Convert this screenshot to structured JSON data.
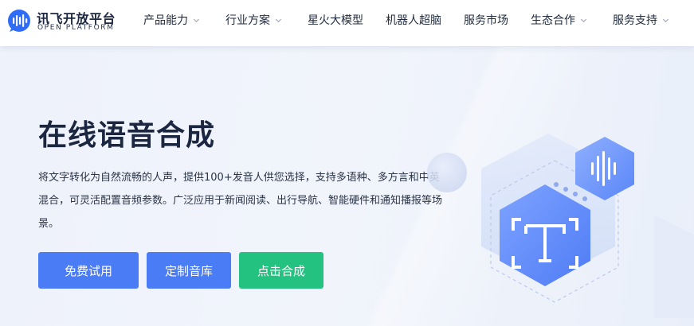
{
  "brand": {
    "name_cn": "讯飞开放平台",
    "name_en": "OPEN PLATFORM"
  },
  "nav": {
    "items": [
      {
        "label": "产品能力",
        "has_dropdown": true
      },
      {
        "label": "行业方案",
        "has_dropdown": true
      },
      {
        "label": "星火大模型",
        "has_dropdown": false
      },
      {
        "label": "机器人超脑",
        "has_dropdown": false
      },
      {
        "label": "服务市场",
        "has_dropdown": false
      },
      {
        "label": "生态合作",
        "has_dropdown": true
      },
      {
        "label": "服务支持",
        "has_dropdown": true
      }
    ]
  },
  "hero": {
    "title": "在线语音合成",
    "description": "将文字转化为自然流畅的人声，提供100+发音人供您选择，支持多语种、多方言和中英混合，可灵活配置音频参数。广泛应用于新闻阅读、出行导航、智能硬件和通知播报等场景。",
    "buttons": {
      "trial": "免费试用",
      "custom": "定制音库",
      "synthesize": "点击合成"
    }
  },
  "icons": {
    "logo": "audio-wave-cloud-icon",
    "dropdown": "chevron-down-icon",
    "text_recognition": "text-t-icon",
    "sound_wave": "sound-wave-icon"
  },
  "colors": {
    "primary": "#4a7cf6",
    "success": "#24c281",
    "title": "#1b2640",
    "hero_bg": "#eef2fa"
  }
}
